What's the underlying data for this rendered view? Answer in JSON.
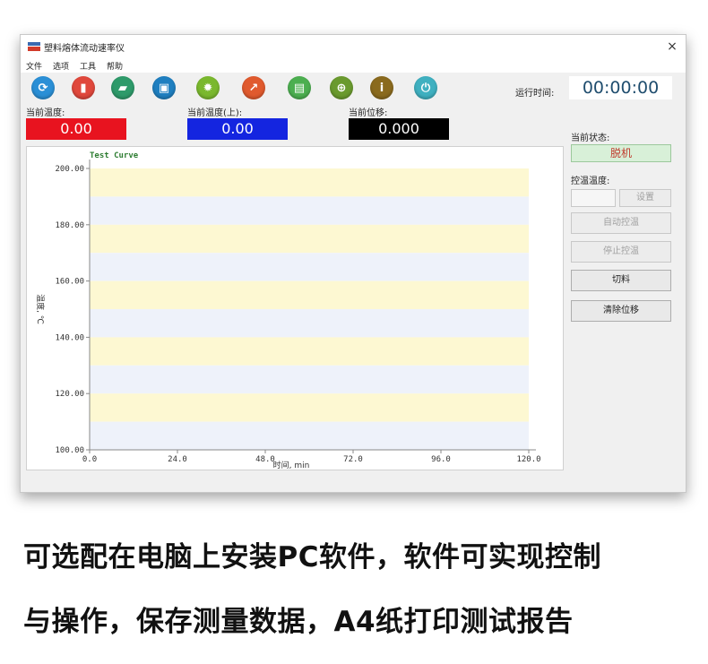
{
  "window": {
    "title": "塑料熔体流动速率仪",
    "close_glyph": "×"
  },
  "menu": [
    "文件",
    "选项",
    "工具",
    "帮助"
  ],
  "toolbar": [
    {
      "name": "refresh-icon",
      "glyph": "⟳",
      "color": "#2a8fd6"
    },
    {
      "name": "new-file-icon",
      "glyph": "▮",
      "color": "#e0483c"
    },
    {
      "name": "open-folder-icon",
      "glyph": "▰",
      "color": "#2e9a6a"
    },
    {
      "name": "save-icon",
      "glyph": "▣",
      "color": "#1f7fc0"
    },
    {
      "name": "settings-gear-icon",
      "glyph": "✹",
      "color": "#7ab82e"
    },
    {
      "name": "export-icon",
      "glyph": "↗",
      "color": "#e05a2e"
    },
    {
      "name": "print-icon",
      "glyph": "▤",
      "color": "#4caf50"
    },
    {
      "name": "zoom-icon",
      "glyph": "⊕",
      "color": "#6a9a2e"
    },
    {
      "name": "info-icon",
      "glyph": "i",
      "color": "#8a6a1e"
    },
    {
      "name": "power-icon",
      "glyph": "⏻",
      "color": "#3fb0c0"
    }
  ],
  "runtime": {
    "label": "运行时间:",
    "value": "00:00:00"
  },
  "readouts": {
    "temp": {
      "label": "当前温度:",
      "value": "0.00",
      "color": "#e8131f"
    },
    "temp_upper": {
      "label": "当前温度(上):",
      "value": "0.00",
      "color": "#1425e0"
    },
    "displacement": {
      "label": "当前位移:",
      "value": "0.000",
      "color": "#000000"
    }
  },
  "side": {
    "status_label": "当前状态:",
    "status_value": "脱机",
    "control_temp_label": "控温温度:",
    "set_button": "设置",
    "auto_control_button": "自动控温",
    "stop_control_button": "停止控温",
    "cut_button": "切料",
    "clear_button": "清除位移"
  },
  "chart_data": {
    "type": "line",
    "title": "Test Curve",
    "xlabel": "时间, min",
    "ylabel": "温度, ℃",
    "xlim": [
      0,
      120
    ],
    "ylim": [
      100,
      200
    ],
    "x_ticks": [
      "0.0",
      "24.0",
      "48.0",
      "72.0",
      "96.0",
      "120.0"
    ],
    "y_ticks": [
      "200.00",
      "180.00",
      "160.00",
      "140.00",
      "120.00",
      "100.00"
    ],
    "series": [],
    "band_colors": [
      "#fdf8d2",
      "#eef2fa"
    ]
  },
  "caption": {
    "line1": "可选配在电脑上安装PC软件，软件可实现控制",
    "line2": "与操作，保存测量数据，A4纸打印测试报告"
  }
}
